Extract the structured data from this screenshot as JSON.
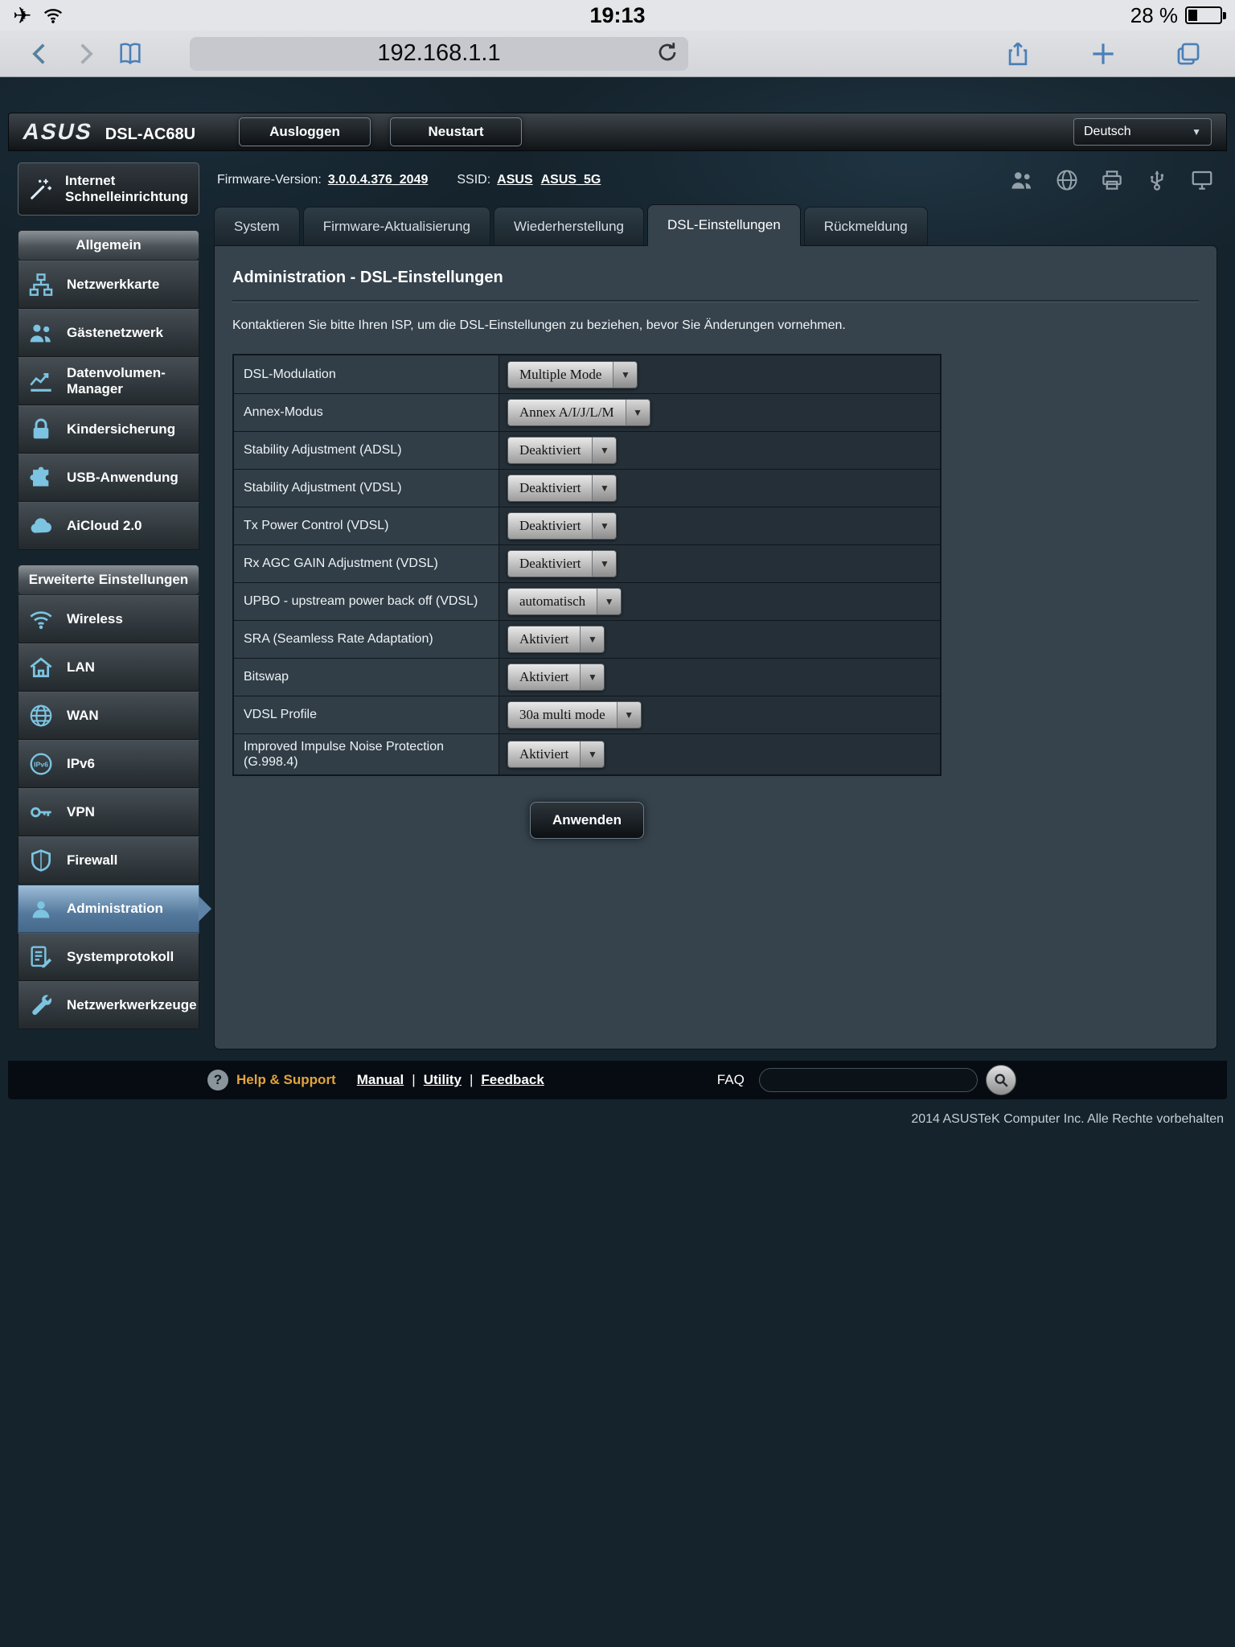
{
  "colors": {
    "accent_icon_blue": "#7cc4e2",
    "active_item_blue": "#54799c",
    "ios_link_blue": "#4a7fb8",
    "help_orange": "#e3a33c",
    "panel_bg": "#36434d",
    "page_bg": "#15232c"
  },
  "ios": {
    "time": "19:13",
    "battery_percent": "28 %",
    "url": "192.168.1.1"
  },
  "header": {
    "brand": "ASUS",
    "model": "DSL-AC68U",
    "logout_label": "Ausloggen",
    "reboot_label": "Neustart",
    "language": "Deutsch",
    "status_icons": [
      {
        "icon": "clients-icon"
      },
      {
        "icon": "internet-globe-icon"
      },
      {
        "icon": "printer-icon"
      },
      {
        "icon": "usb-device-icon"
      },
      {
        "icon": "pc-icon"
      }
    ]
  },
  "infobar": {
    "firmware_label": "Firmware-Version:",
    "firmware_value": "3.0.0.4.376_2049",
    "ssid_label": "SSID:",
    "ssids": [
      {
        "label": "ASUS"
      },
      {
        "label": "ASUS_5G"
      }
    ]
  },
  "tabs": [
    {
      "label": "System"
    },
    {
      "label": "Firmware-Aktualisierung"
    },
    {
      "label": "Wiederherstellung"
    },
    {
      "label": "DSL-Einstellungen",
      "active": true
    },
    {
      "label": "Rückmeldung"
    }
  ],
  "sidebar": {
    "quick": {
      "line1": "Internet",
      "line2": "Schnelleinrichtung",
      "icon": "wand-icon"
    },
    "general": {
      "title": "Allgemein",
      "items": [
        {
          "label": "Netzwerkkarte",
          "icon": "network-map-icon"
        },
        {
          "label": "Gästenetzwerk",
          "icon": "guest-network-icon"
        },
        {
          "label": "Datenvolumen-Manager",
          "icon": "traffic-manager-icon"
        },
        {
          "label": "Kindersicherung",
          "icon": "parental-lock-icon"
        },
        {
          "label": "USB-Anwendung",
          "icon": "usb-app-icon"
        },
        {
          "label": "AiCloud 2.0",
          "icon": "cloud-icon"
        }
      ]
    },
    "advanced": {
      "title": "Erweiterte Einstellungen",
      "items": [
        {
          "label": "Wireless",
          "icon": "wifi-icon"
        },
        {
          "label": "LAN",
          "icon": "home-icon"
        },
        {
          "label": "WAN",
          "icon": "globe-icon"
        },
        {
          "label": "IPv6",
          "icon": "ipv6-icon"
        },
        {
          "label": "VPN",
          "icon": "vpn-key-icon"
        },
        {
          "label": "Firewall",
          "icon": "shield-icon"
        },
        {
          "label": "Administration",
          "icon": "admin-user-icon",
          "active": true
        },
        {
          "label": "Systemprotokoll",
          "icon": "syslog-icon"
        },
        {
          "label": "Netzwerkwerkzeuge",
          "icon": "tools-icon"
        }
      ]
    }
  },
  "content": {
    "title": "Administration - DSL-Einstellungen",
    "description": "Kontaktieren Sie bitte Ihren ISP, um die DSL-Einstellungen zu beziehen, bevor Sie Änderungen vornehmen.",
    "rows": [
      {
        "label": "DSL-Modulation",
        "value": "Multiple Mode"
      },
      {
        "label": "Annex-Modus",
        "value": "Annex A/I/J/L/M"
      },
      {
        "label": "Stability Adjustment (ADSL)",
        "value": "Deaktiviert"
      },
      {
        "label": "Stability Adjustment (VDSL)",
        "value": "Deaktiviert"
      },
      {
        "label": "Tx Power Control (VDSL)",
        "value": "Deaktiviert"
      },
      {
        "label": "Rx AGC GAIN Adjustment (VDSL)",
        "value": "Deaktiviert"
      },
      {
        "label": "UPBO - upstream power back off (VDSL)",
        "value": "automatisch"
      },
      {
        "label": "SRA (Seamless Rate Adaptation)",
        "value": "Aktiviert"
      },
      {
        "label": "Bitswap",
        "value": "Aktiviert"
      },
      {
        "label": "VDSL Profile",
        "value": "30a multi mode"
      },
      {
        "label": "Improved Impulse Noise Protection (G.998.4)",
        "value": "Aktiviert"
      }
    ],
    "apply_label": "Anwenden"
  },
  "footer": {
    "help_label": "Help & Support",
    "links": [
      {
        "label": "Manual"
      },
      {
        "label": "Utility"
      },
      {
        "label": "Feedback"
      }
    ],
    "faq_label": "FAQ"
  },
  "copyright": "2014 ASUSTeK Computer Inc. Alle Rechte vorbehalten"
}
